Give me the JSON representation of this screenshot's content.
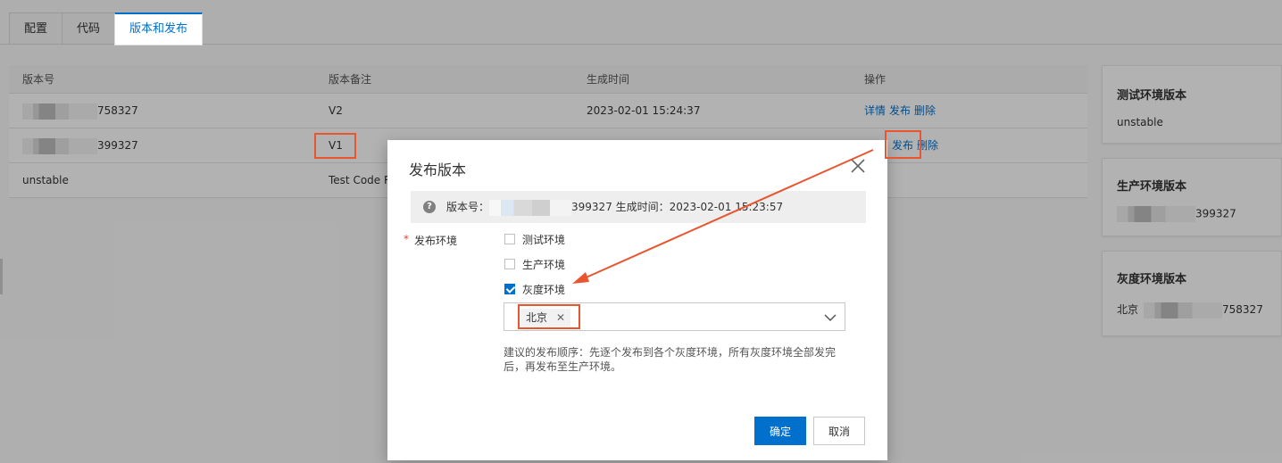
{
  "tabs": [
    {
      "label": "配置"
    },
    {
      "label": "代码"
    },
    {
      "label": "版本和发布"
    }
  ],
  "table": {
    "headers": {
      "version": "版本号",
      "note": "版本备注",
      "time": "生成时间",
      "ops": "操作"
    },
    "rows": [
      {
        "version": "758327",
        "note": "V2",
        "time": "2023-02-01 15:24:37",
        "detail": "详情",
        "publish": "发布",
        "delete": "删除"
      },
      {
        "version": "399327",
        "note": "V1",
        "time": "",
        "detail": "",
        "publish": "发布",
        "delete": "删除"
      },
      {
        "version": "unstable",
        "note": "Test Code Re",
        "time": "",
        "detail": "",
        "publish": "",
        "delete": ""
      }
    ]
  },
  "cards": {
    "test": {
      "title": "测试环境版本",
      "value": "unstable"
    },
    "prod": {
      "title": "生产环境版本",
      "value": "399327"
    },
    "gray": {
      "title": "灰度环境版本",
      "prefix": "北京",
      "value": "758327"
    }
  },
  "modal": {
    "title": "发布版本",
    "info_prefix": "版本号：",
    "info_suffix": "399327 生成时间：2023-02-01 15:23:57",
    "required_mark": "*",
    "env_label": "发布环境",
    "options": [
      {
        "label": "测试环境",
        "checked": false
      },
      {
        "label": "生产环境",
        "checked": false
      },
      {
        "label": "灰度环境",
        "checked": true
      }
    ],
    "selected_region": "北京",
    "hint": "建议的发布顺序：先逐个发布到各个灰度环境，所有灰度环境全部发完后，再发布至生产环境。",
    "confirm": "确定",
    "cancel": "取消"
  },
  "colors": {
    "accent": "#0070cc",
    "highlight": "#e8552e"
  }
}
